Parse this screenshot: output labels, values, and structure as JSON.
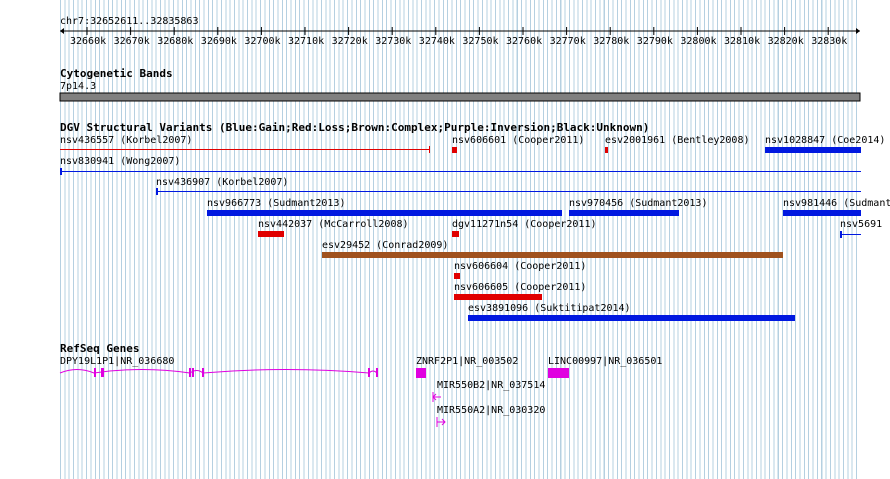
{
  "ruler": {
    "location": "chr7:32652611..32835863",
    "ticks": [
      "32660k",
      "32670k",
      "32680k",
      "32690k",
      "32700k",
      "32710k",
      "32720k",
      "32730k",
      "32740k",
      "32750k",
      "32760k",
      "32770k",
      "32780k",
      "32790k",
      "32800k",
      "32810k",
      "32820k",
      "32830k"
    ]
  },
  "cyto": {
    "title": "Cytogenetic Bands",
    "band": "7p14.3"
  },
  "dgv": {
    "title": "DGV Structural Variants (Blue:Gain;Red:Loss;Brown:Complex;Purple:Inversion;Black:Unknown)",
    "features": [
      {
        "label": "nsv436557 (Korbel2007)",
        "color": "#e00000"
      },
      {
        "label": "nsv606601 (Cooper2011)",
        "color": "#e00000"
      },
      {
        "label": "esv2001961 (Bentley2008)",
        "color": "#e00000"
      },
      {
        "label": "nsv1028847 (Coe2014)",
        "color": "#0018e0"
      },
      {
        "label": "nsv830941 (Wong2007)",
        "color": "#0018e0"
      },
      {
        "label": "nsv436907 (Korbel2007)",
        "color": "#0018e0"
      },
      {
        "label": "nsv966773 (Sudmant2013)",
        "color": "#0018e0"
      },
      {
        "label": "nsv970456 (Sudmant2013)",
        "color": "#0018e0"
      },
      {
        "label": "nsv981446 (Sudmant",
        "color": "#0018e0"
      },
      {
        "label": "nsv442037 (McCarroll2008)",
        "color": "#e00000"
      },
      {
        "label": "dgv11271n54 (Cooper2011)",
        "color": "#e00000"
      },
      {
        "label": "nsv5691",
        "color": "#0018e0"
      },
      {
        "label": "esv29452 (Conrad2009)",
        "color": "#a0521e"
      },
      {
        "label": "nsv606604 (Cooper2011)",
        "color": "#e00000"
      },
      {
        "label": "nsv606605 (Cooper2011)",
        "color": "#e00000"
      },
      {
        "label": "esv3891096 (Suktitipat2014)",
        "color": "#0018e0"
      }
    ]
  },
  "refseq": {
    "title": "RefSeq Genes",
    "color": "#e000e0",
    "genes": [
      {
        "label": "DPY19L1P1|NR_036680"
      },
      {
        "label": "ZNRF2P1|NR_003502"
      },
      {
        "label": "LINC00997|NR_036501"
      },
      {
        "label": "MIR550B2|NR_037514"
      },
      {
        "label": "MIR550A2|NR_030320"
      }
    ]
  }
}
